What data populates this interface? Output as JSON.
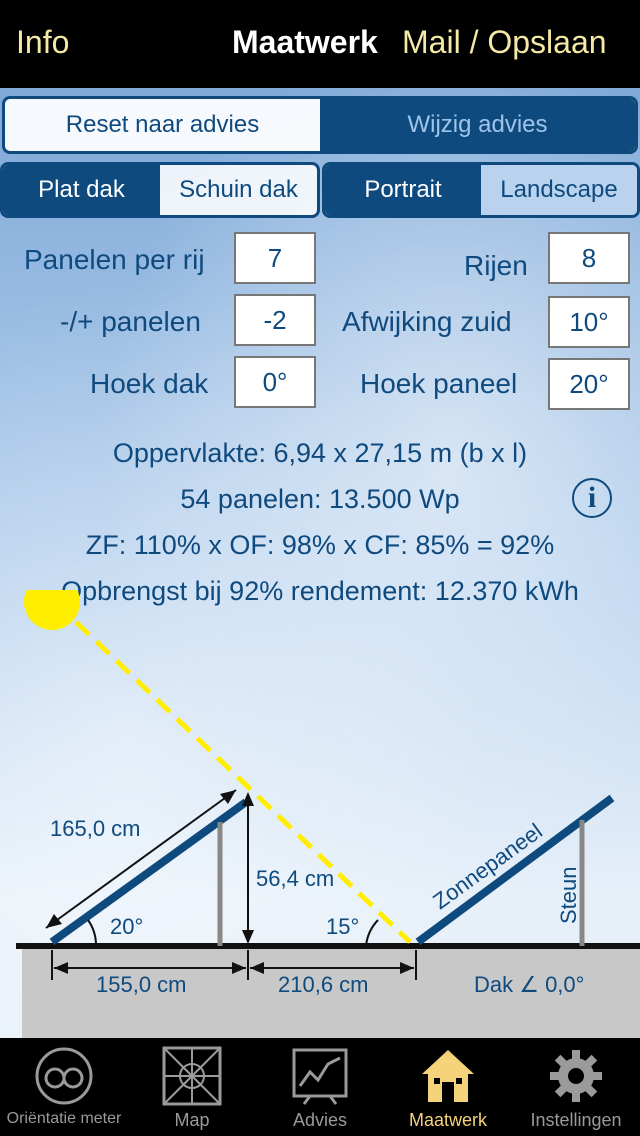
{
  "navbar": {
    "left": "Info",
    "title": "Maatwerk",
    "right": "Mail / Opslaan"
  },
  "advice": {
    "reset": "Reset naar advies",
    "change": "Wijzig advies"
  },
  "roof_type": {
    "flat": "Plat dak",
    "slanted": "Schuin dak",
    "selected": "Plat dak"
  },
  "orientation": {
    "portrait": "Portrait",
    "landscape": "Landscape",
    "selected": "Portrait"
  },
  "fields": {
    "panels_per_row": {
      "label": "Panelen per rij",
      "value": "7"
    },
    "rows": {
      "label": "Rijen",
      "value": "8"
    },
    "plus_minus": {
      "label": "-/+ panelen",
      "value": "-2"
    },
    "deviation_south": {
      "label": "Afwijking zuid",
      "value": "10°"
    },
    "roof_angle": {
      "label": "Hoek dak",
      "value": "0°"
    },
    "panel_angle": {
      "label": "Hoek paneel",
      "value": "20°"
    }
  },
  "results": {
    "area": "Oppervlakte: 6,94 x 27,15 m (b x l)",
    "panels": "54 panelen: 13.500 Wp",
    "factors": "ZF: 110% x OF: 98% x CF: 85% = 92%",
    "yield": "Opbrengst bij 92% rendement: 12.370 kWh",
    "info_icon": "i"
  },
  "diagram": {
    "panel_length": "165,0 cm",
    "height": "56,4 cm",
    "panel_angle": "20°",
    "sun_angle": "15°",
    "base_width": "155,0 cm",
    "spacing": "210,6 cm",
    "panel_label": "Zonnepaneel",
    "support_label": "Steun",
    "roof_label": "Dak ∠ 0,0°",
    "sun_color": "#ffee00",
    "panel_color": "#0f4a7f"
  },
  "tabs": [
    {
      "label": "Oriëntatie meter",
      "icon": "orientation-meter-icon"
    },
    {
      "label": "Map",
      "icon": "map-icon"
    },
    {
      "label": "Advies",
      "icon": "advice-chart-icon"
    },
    {
      "label": "Maatwerk",
      "icon": "house-icon",
      "active": true
    },
    {
      "label": "Instellingen",
      "icon": "gear-icon"
    }
  ]
}
